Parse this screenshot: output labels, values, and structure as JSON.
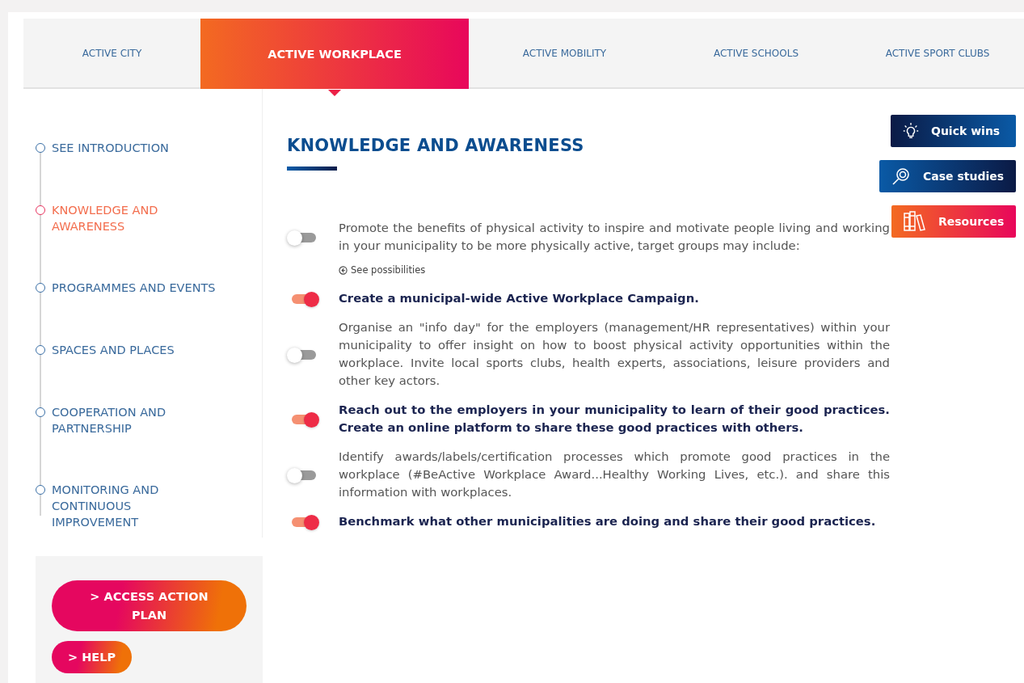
{
  "tabs": [
    {
      "label": "ACTIVE CITY",
      "selected": false
    },
    {
      "label": "ACTIVE WORKPLACE",
      "selected": true
    },
    {
      "label": "ACTIVE MOBILITY",
      "selected": false
    },
    {
      "label": "ACTIVE SCHOOLS",
      "selected": false
    },
    {
      "label": "ACTIVE SPORT CLUBS",
      "selected": false
    }
  ],
  "sidebar": {
    "items": [
      {
        "label": "SEE INTRODUCTION",
        "selected": false
      },
      {
        "label": "KNOWLEDGE AND AWARENESS",
        "selected": true
      },
      {
        "label": "PROGRAMMES AND EVENTS",
        "selected": false
      },
      {
        "label": "SPACES AND PLACES",
        "selected": false
      },
      {
        "label": "COOPERATION AND PARTNERSHIP",
        "selected": false
      },
      {
        "label": "MONITORING AND CONTINUOUS IMPROVEMENT",
        "selected": false
      }
    ],
    "buttons": [
      {
        "label": "> ACCESS ACTION PLAN",
        "kind": "wide"
      },
      {
        "label": "> HELP",
        "kind": "small"
      }
    ]
  },
  "heading": "KNOWLEDGE AND AWARENESS",
  "side_buttons": [
    {
      "label": "Quick wins",
      "kind": "bulb"
    },
    {
      "label": "Case studies",
      "kind": "magnifier"
    },
    {
      "label": "Resources",
      "kind": "books"
    }
  ],
  "items": [
    {
      "text": "Promote the benefits of physical activity to inspire and motivate people living and working in your municipality to be more physically active, target groups may include:",
      "on": false,
      "link": "See possibilities"
    },
    {
      "text": "Create a municipal-wide Active Workplace Campaign.",
      "on": true
    },
    {
      "text": "Organise an \"info day\" for the employers (management/HR representatives) within your municipality to offer insight on how to boost physical activity opportunities within the workplace. Invite local sports clubs, health experts, associations, leisure providers and other key actors.",
      "on": false
    },
    {
      "text": "Reach out to the employers in your municipality to learn of their good practices. Create an online platform to share these good practices with others.",
      "on": true
    },
    {
      "text": "Identify awards/labels/certification processes which promote good practices in the workplace (#BeActive Workplace Award...Healthy Working Lives, etc.). and share this information with workplaces.",
      "on": false
    },
    {
      "text": "Benchmark what other municipalities are doing and share their good practices.",
      "on": true
    }
  ]
}
